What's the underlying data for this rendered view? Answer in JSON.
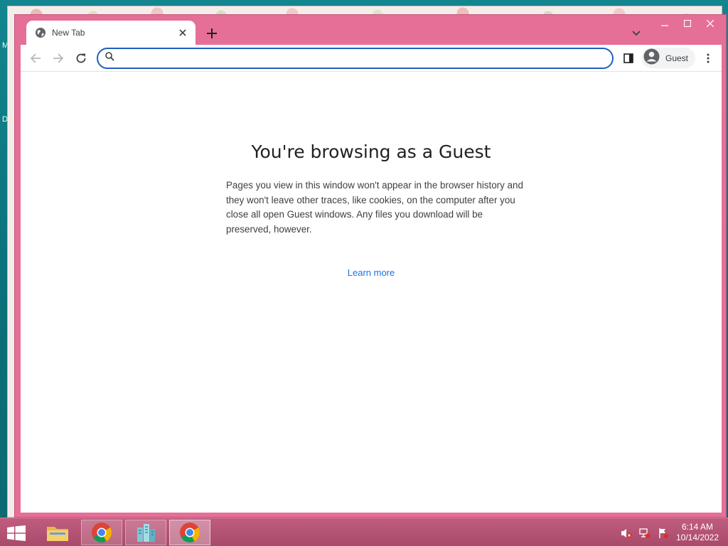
{
  "desktop": {
    "labels": [
      "M",
      "D"
    ]
  },
  "browser": {
    "tab": {
      "title": "New Tab",
      "favicon": "globe-icon"
    },
    "toolbar": {
      "back_icon": "arrow-left-icon",
      "forward_icon": "arrow-right-icon",
      "reload_icon": "reload-icon",
      "omnibox_value": "",
      "profile_label": "Guest"
    },
    "page": {
      "heading": "You're browsing as a Guest",
      "body": "Pages you view in this window won't appear in the browser history and they won't leave other traces, like cookies, on the computer after you close all open Guest windows. Any files you download will be preserved, however.",
      "learn_more": "Learn more"
    },
    "colors": {
      "frame": "#e56f97",
      "link": "#1a73e8",
      "omnibox_border": "#1f5fbf"
    }
  },
  "taskbar": {
    "items": [
      "file-explorer",
      "chrome",
      "server-manager",
      "chrome-active"
    ],
    "tray_icons": [
      "volume-muted-icon",
      "network-icon",
      "action-center-flag-icon"
    ],
    "clock": {
      "time": "6:14 AM",
      "date": "10/14/2022"
    }
  }
}
